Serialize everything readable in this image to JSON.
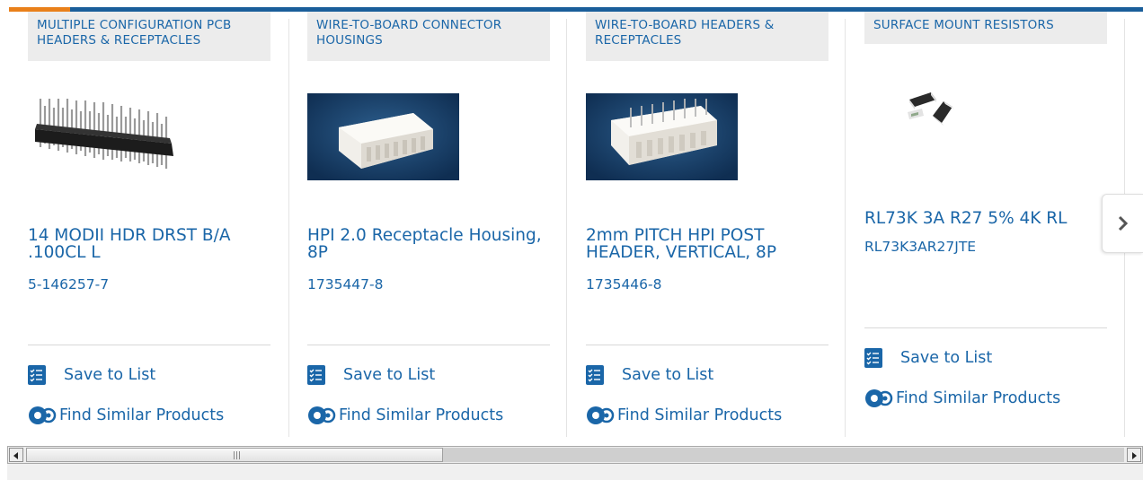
{
  "cards": [
    {
      "category": "MULTIPLE CONFIGURATION PCB HEADERS & RECEPTACLES",
      "image_alt": "pin-header-image",
      "title": "14 MODII HDR DRST B/A .100CL L",
      "part_number": "5-146257-7",
      "save_label": "Save to List",
      "similar_label": "Find Similar Products"
    },
    {
      "category": "WIRE-TO-BOARD CONNECTOR HOUSINGS",
      "image_alt": "receptacle-housing-image",
      "title": "HPI 2.0 Receptacle Housing, 8P",
      "part_number": "1735447-8",
      "save_label": "Save to List",
      "similar_label": "Find Similar Products"
    },
    {
      "category": "WIRE-TO-BOARD HEADERS & RECEPTACLES",
      "image_alt": "post-header-image",
      "title": "2mm PITCH HPI POST HEADER, VERTICAL, 8P",
      "part_number": "1735446-8",
      "save_label": "Save to List",
      "similar_label": "Find Similar Products"
    },
    {
      "category": "SURFACE MOUNT RESISTORS",
      "image_alt": "smd-resistor-image",
      "title": "RL73K 3A R27 5% 4K RL",
      "part_number": "RL73K3AR27JTE",
      "save_label": "Save to List",
      "similar_label": "Find Similar Products"
    }
  ],
  "icons": {
    "save": "list-checklist-icon",
    "similar": "gears-icon",
    "next": "chevron-right-icon"
  },
  "colors": {
    "brand_blue": "#1a66a8",
    "accent_orange": "#e9801a",
    "category_bg": "#ececec"
  }
}
